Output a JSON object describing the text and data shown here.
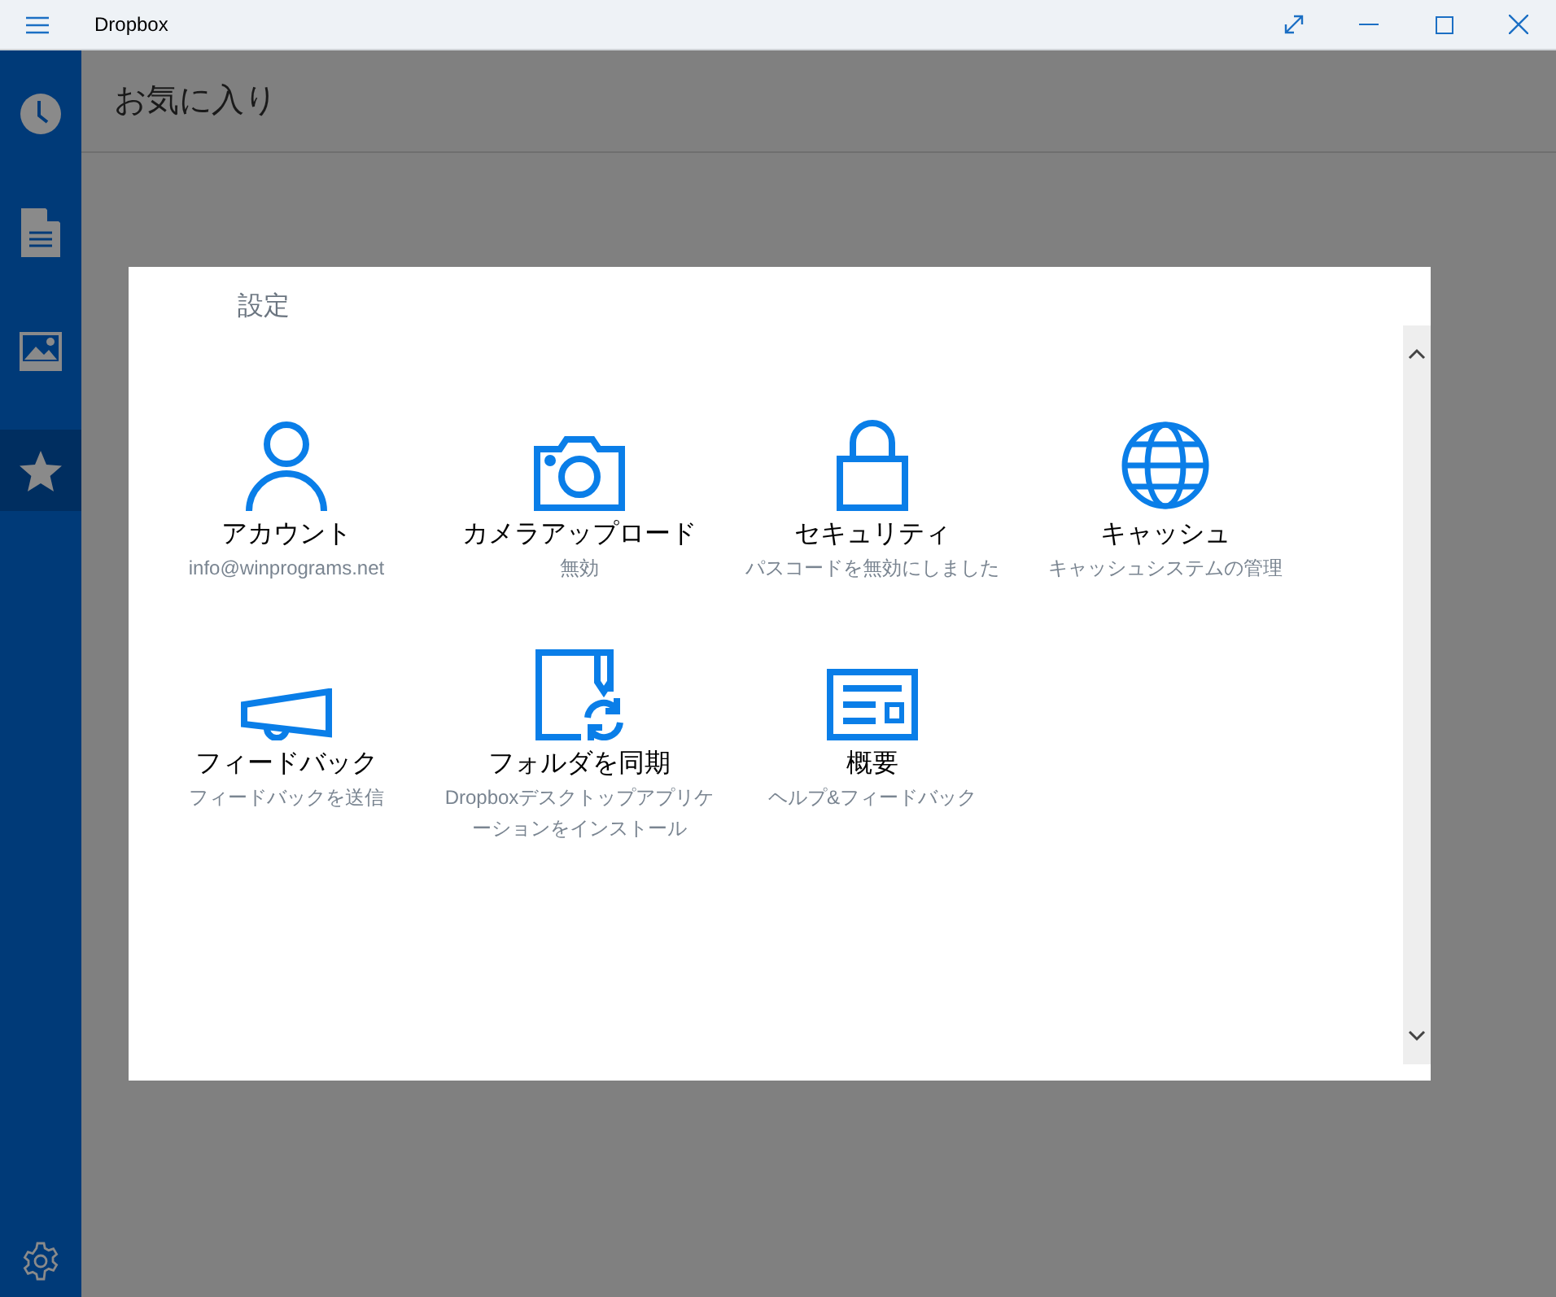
{
  "window": {
    "title": "Dropbox"
  },
  "sidebar": {
    "items": [
      {
        "selected": false
      },
      {
        "selected": false
      },
      {
        "selected": false
      },
      {
        "selected": true
      }
    ]
  },
  "page": {
    "title": "お気に入り"
  },
  "dialog": {
    "title": "設定",
    "tiles": [
      {
        "title": "アカウント",
        "subtitle": "info@winprograms.net"
      },
      {
        "title": "カメラアップロード",
        "subtitle": "無効"
      },
      {
        "title": "セキュリティ",
        "subtitle": "パスコードを無効にしました"
      },
      {
        "title": "キャッシュ",
        "subtitle": "キャッシュシステムの管理"
      },
      {
        "title": "フィードバック",
        "subtitle": "フィードバックを送信"
      },
      {
        "title": "フォルダを同期",
        "subtitle": "Dropboxデスクトップアプリケーションをインストール"
      },
      {
        "title": "概要",
        "subtitle": "ヘルプ&フィードバック"
      }
    ]
  }
}
